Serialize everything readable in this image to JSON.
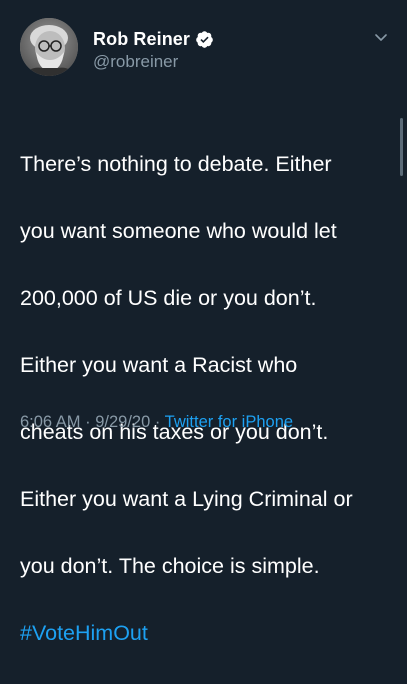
{
  "author": {
    "display_name": "Rob Reiner",
    "handle": "@robreiner",
    "verified": true
  },
  "tweet": {
    "lines": [
      "There’s nothing to debate. Either",
      "you want someone who would let",
      "200,000 of US die or you don’t.",
      "Either you want a Racist who",
      "cheats on his taxes or you don’t.",
      "Either you want a Lying Criminal or",
      "you don’t. The choice is simple."
    ],
    "hashtag": "#VoteHimOut"
  },
  "meta": {
    "time": "6:06 AM",
    "separator1": " · ",
    "date": "9/29/20",
    "separator2": " · ",
    "source": "Twitter for iPhone"
  },
  "icons": {
    "verified": "verified-badge-icon",
    "menu": "chevron-down-icon"
  },
  "colors": {
    "background": "#15202b",
    "text": "#ffffff",
    "secondary": "#8899a6",
    "accent": "#1da1f2"
  }
}
